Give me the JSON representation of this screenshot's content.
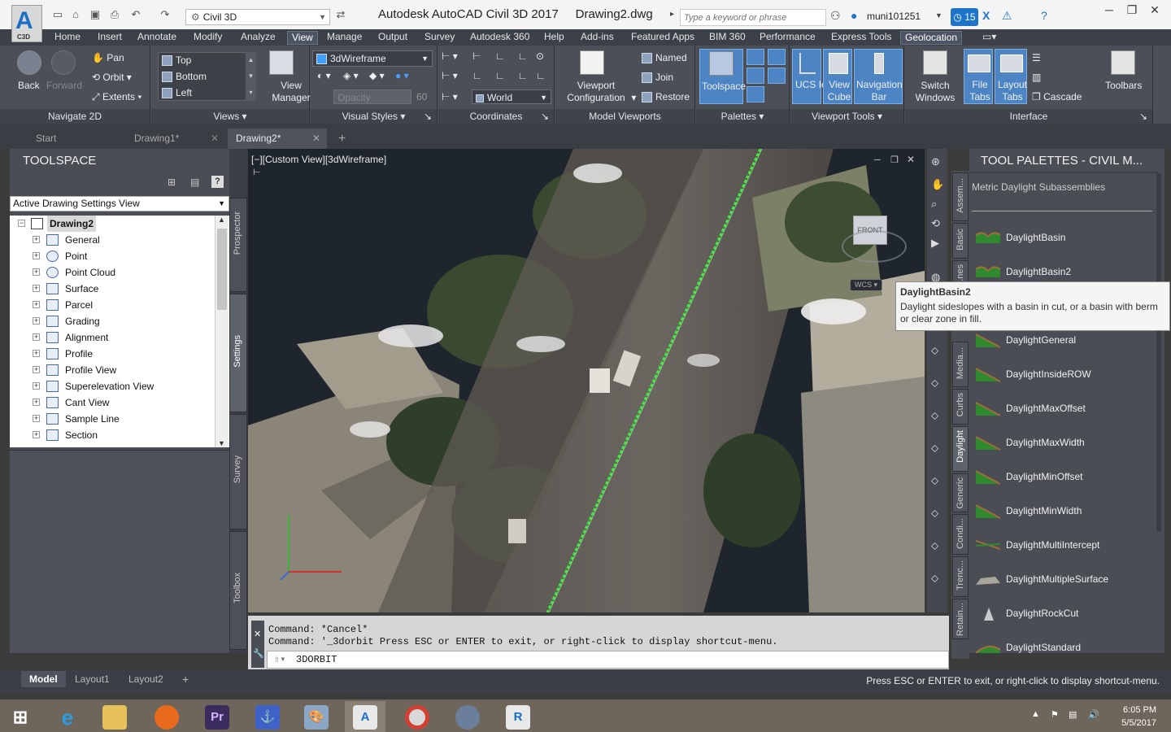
{
  "app": {
    "logo_letter": "A",
    "logo_sub": "C3D",
    "workspace": "Civil 3D",
    "title": "Autodesk AutoCAD Civil 3D 2017",
    "document": "Drawing2.dwg",
    "search_placeholder": "Type a keyword or phrase",
    "user": "muni101251",
    "notif_count": "15"
  },
  "menu_tabs": [
    "Home",
    "Insert",
    "Annotate",
    "Modify",
    "Analyze",
    "View",
    "Manage",
    "Output",
    "Survey",
    "Autodesk 360",
    "Help",
    "Add-ins",
    "Featured Apps",
    "BIM 360",
    "Performance",
    "Express Tools",
    "Geolocation"
  ],
  "ribbon": {
    "navigate": {
      "title": "Navigate 2D",
      "back": "Back",
      "forward": "Forward",
      "pan": "Pan",
      "orbit": "Orbit",
      "extents": "Extents"
    },
    "views": {
      "title": "Views",
      "items": [
        "Top",
        "Bottom",
        "Left"
      ],
      "view_manager": "View Manager"
    },
    "visual_styles": {
      "title": "Visual Styles",
      "current": "3dWireframe",
      "opacity_label": "Opacity",
      "opacity_value": "60"
    },
    "coordinates": {
      "title": "Coordinates",
      "ucs": "World"
    },
    "model_viewports": {
      "title": "Model Viewports",
      "viewport_config": "Viewport Configuration",
      "named": "Named",
      "join": "Join",
      "restore": "Restore"
    },
    "palettes": {
      "title": "Palettes",
      "toolspace": "Toolspace"
    },
    "viewport_tools": {
      "title": "Viewport Tools",
      "ucs_icon": "UCS Icon",
      "view_cube": "View Cube",
      "navigation_bar": "Navigation Bar"
    },
    "interface": {
      "title": "Interface",
      "switch_windows": "Switch Windows",
      "file_tabs": "File Tabs",
      "layout_tabs": "Layout Tabs",
      "cascade": "Cascade"
    },
    "toolbars": "Toolbars"
  },
  "file_tabs": [
    "Start",
    "Drawing1*",
    "Drawing2*"
  ],
  "toolspace": {
    "title": "TOOLSPACE",
    "view": "Active Drawing Settings View",
    "root": "Drawing2",
    "items": [
      "General",
      "Point",
      "Point Cloud",
      "Surface",
      "Parcel",
      "Grading",
      "Alignment",
      "Profile",
      "Profile View",
      "Superelevation View",
      "Cant View",
      "Sample Line",
      "Section"
    ],
    "side_tabs": [
      "Prospector",
      "Settings",
      "Survey",
      "Toolbox"
    ]
  },
  "viewport": {
    "label": "[−][Custom View][3dWireframe]",
    "viewcube_face": "FRONT",
    "wcs": "WCS"
  },
  "command": {
    "history": [
      "Command: *Cancel*",
      "Command: '_3dorbit Press ESC or ENTER to exit, or right-click to display shortcut-menu."
    ],
    "input": "3DORBIT"
  },
  "tool_palettes": {
    "title": "TOOL PALETTES - CIVIL M...",
    "subtitle": "Metric Daylight Subassemblies",
    "items": [
      "DaylightBasin",
      "DaylightBasin2",
      "DaylightGeneral",
      "DaylightInsideROW",
      "DaylightMaxOffset",
      "DaylightMaxWidth",
      "DaylightMinOffset",
      "DaylightMinWidth",
      "DaylightMultiIntercept",
      "DaylightMultipleSurface",
      "DaylightRockCut",
      "DaylightStandard"
    ],
    "side_tabs": [
      "Assem...",
      "Basic",
      "...nes",
      "Media...",
      "Curbs",
      "Daylight",
      "Generic",
      "Condi...",
      "Trenc...",
      "Retain..."
    ],
    "tooltip_title": "DaylightBasin2",
    "tooltip_text": "Daylight sideslopes with a basin in cut, or a basin with berm or clear zone in fill."
  },
  "layout_tabs": [
    "Model",
    "Layout1",
    "Layout2"
  ],
  "status_message": "Press ESC or ENTER to exit, or right-click to display shortcut-menu.",
  "taskbar": {
    "time": "6:05 PM",
    "date": "5/5/2017"
  },
  "colors": {
    "accent": "#1e74c8",
    "ribbon_bg": "#4a4f58",
    "highlight": "#4c84c4",
    "pointcloud_green": "#3ee83e"
  }
}
